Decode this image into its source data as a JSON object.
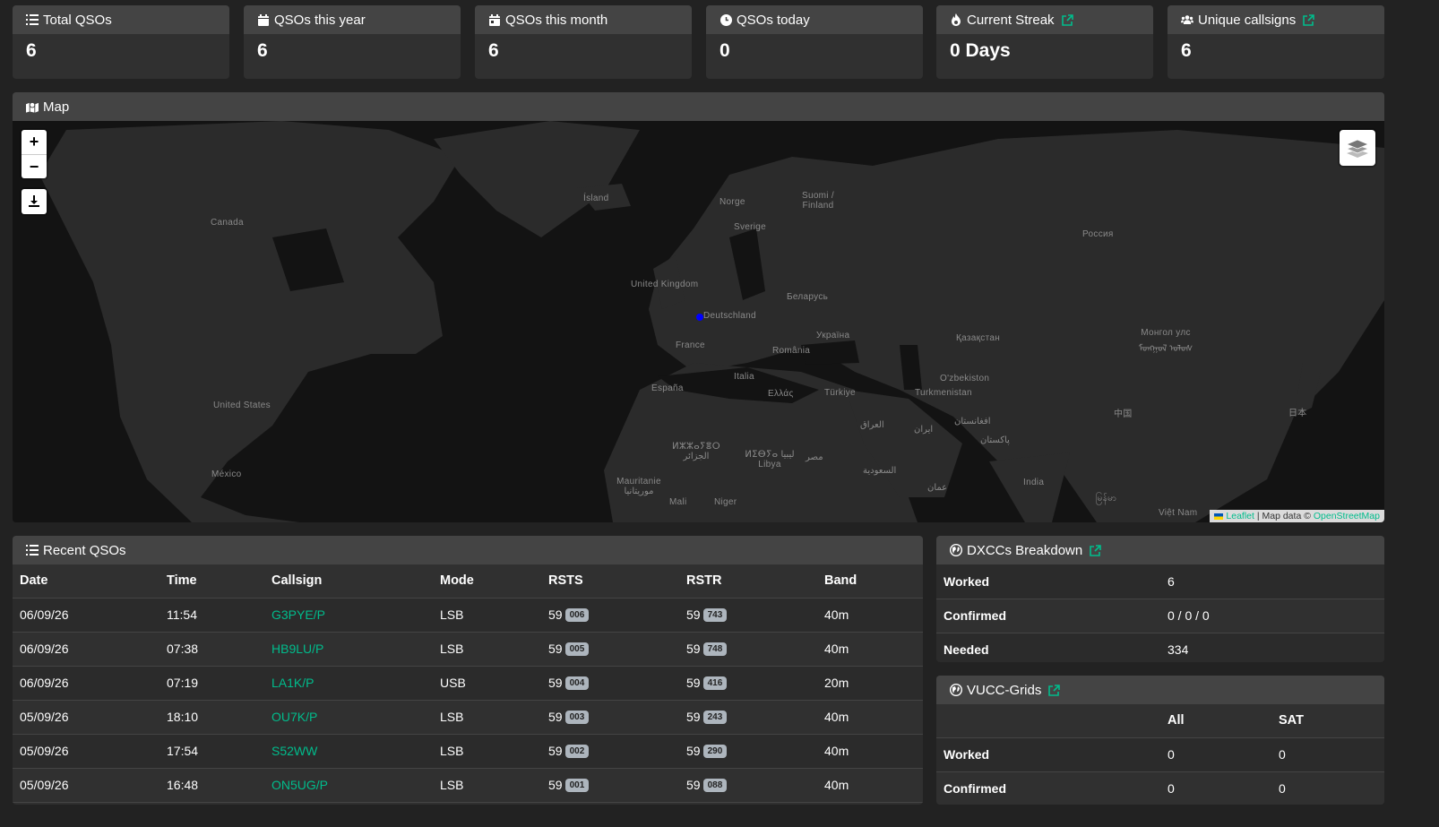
{
  "stats": [
    {
      "label": "Total QSOs",
      "value": "6",
      "icon": "list-icon",
      "external": false
    },
    {
      "label": "QSOs this year",
      "value": "6",
      "icon": "calendar-icon",
      "external": false
    },
    {
      "label": "QSOs this month",
      "value": "6",
      "icon": "calendar-month-icon",
      "external": false
    },
    {
      "label": "QSOs today",
      "value": "0",
      "icon": "clock-icon",
      "external": false
    },
    {
      "label": "Current Streak",
      "value": "0 Days",
      "icon": "fire-icon",
      "external": true
    },
    {
      "label": "Unique callsigns",
      "value": "6",
      "icon": "users-icon",
      "external": true
    }
  ],
  "map": {
    "title": "Map",
    "zoom_in": "+",
    "zoom_out": "−",
    "attribution_leaflet": "Leaflet",
    "attribution_sep": " | Map data © ",
    "attribution_osm": "OpenStreetMap",
    "labels": [
      "Canada",
      "United States",
      "México",
      "Ísland",
      "Norge",
      "Sverige",
      "Suomi / Finland",
      "United Kingdom",
      "Deutschland",
      "France",
      "España",
      "Italia",
      "Беларусь",
      "Україна",
      "România",
      "Ελλάς",
      "Türkiye",
      "Россия",
      "Қазақстан",
      "O'zbekiston",
      "Turkmenistan",
      "Монгол улс ᠮᠣᠩᠭᠣᠯ ᠤᠯᠤᠰ",
      "中国",
      "日本",
      "العراق",
      "ایران",
      "افغانستان",
      "پاکستان",
      "India",
      "ⵍⵣⵣⴰⵢⴻⵔ الجزائر",
      "ⵍⵉⴱⵢⴰ ليبيا Libya",
      "مصر",
      "السعودية",
      "عمان",
      "Mauritanie موريتانيا",
      "Mali",
      "Niger",
      "Việt Nam",
      "မြန်မာ"
    ],
    "colors": {
      "land": "#2b2b2b",
      "water": "#131313",
      "marker": "#0000ff"
    }
  },
  "recent": {
    "title": "Recent QSOs",
    "columns": [
      "Date",
      "Time",
      "Callsign",
      "Mode",
      "RSTS",
      "RSTR",
      "Band"
    ],
    "rows": [
      {
        "date": "06/09/26",
        "time": "11:54",
        "callsign": "G3PYE/P",
        "mode": "LSB",
        "rsts": "59",
        "rsts_serial": "006",
        "rstr": "59",
        "rstr_serial": "743",
        "band": "40m"
      },
      {
        "date": "06/09/26",
        "time": "07:38",
        "callsign": "HB9LU/P",
        "mode": "LSB",
        "rsts": "59",
        "rsts_serial": "005",
        "rstr": "59",
        "rstr_serial": "748",
        "band": "40m"
      },
      {
        "date": "06/09/26",
        "time": "07:19",
        "callsign": "LA1K/P",
        "mode": "USB",
        "rsts": "59",
        "rsts_serial": "004",
        "rstr": "59",
        "rstr_serial": "416",
        "band": "20m"
      },
      {
        "date": "05/09/26",
        "time": "18:10",
        "callsign": "OU7K/P",
        "mode": "LSB",
        "rsts": "59",
        "rsts_serial": "003",
        "rstr": "59",
        "rstr_serial": "243",
        "band": "40m"
      },
      {
        "date": "05/09/26",
        "time": "17:54",
        "callsign": "S52WW",
        "mode": "LSB",
        "rsts": "59",
        "rsts_serial": "002",
        "rstr": "59",
        "rstr_serial": "290",
        "band": "40m"
      },
      {
        "date": "05/09/26",
        "time": "16:48",
        "callsign": "ON5UG/P",
        "mode": "LSB",
        "rsts": "59",
        "rsts_serial": "001",
        "rstr": "59",
        "rstr_serial": "088",
        "band": "40m"
      }
    ]
  },
  "dxcc": {
    "title": "DXCCs Breakdown",
    "rows": [
      {
        "label": "Worked",
        "value": "6"
      },
      {
        "label": "Confirmed",
        "value": "0 / 0 / 0"
      },
      {
        "label": "Needed",
        "value": "334"
      }
    ]
  },
  "vucc": {
    "title": "VUCC-Grids",
    "columns": [
      "",
      "All",
      "SAT"
    ],
    "rows": [
      {
        "label": "Worked",
        "all": "0",
        "sat": "0"
      },
      {
        "label": "Confirmed",
        "all": "0",
        "sat": "0"
      }
    ]
  },
  "accent_color": "#00bc8c"
}
